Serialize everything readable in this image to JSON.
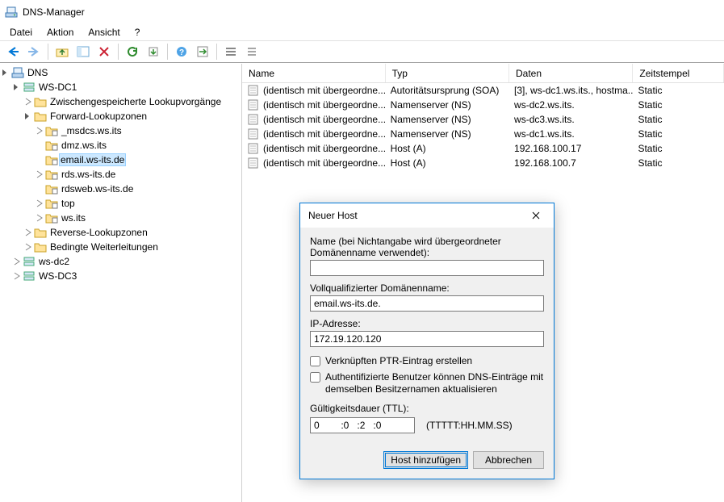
{
  "app": {
    "title": "DNS-Manager"
  },
  "menu": {
    "file": "Datei",
    "action": "Aktion",
    "view": "Ansicht",
    "help": "?"
  },
  "tree": {
    "root": "DNS",
    "server1": "WS-DC1",
    "cached": "Zwischengespeicherte Lookupvorgänge",
    "fwd": "Forward-Lookupzonen",
    "zones": [
      "_msdcs.ws.its",
      "dmz.ws.its",
      "email.ws-its.de",
      "rds.ws-its.de",
      "rdsweb.ws-its.de",
      "top",
      "ws.its"
    ],
    "rev": "Reverse-Lookupzonen",
    "cond": "Bedingte Weiterleitungen",
    "server2": "ws-dc2",
    "server3": "WS-DC3"
  },
  "columns": {
    "name": "Name",
    "type": "Typ",
    "data": "Daten",
    "timestamp": "Zeitstempel"
  },
  "records": [
    {
      "name": "(identisch mit übergeordne...",
      "type": "Autoritätsursprung (SOA)",
      "data": "[3], ws-dc1.ws.its., hostma...",
      "ts": "Static"
    },
    {
      "name": "(identisch mit übergeordne...",
      "type": "Namenserver (NS)",
      "data": "ws-dc2.ws.its.",
      "ts": "Static"
    },
    {
      "name": "(identisch mit übergeordne...",
      "type": "Namenserver (NS)",
      "data": "ws-dc3.ws.its.",
      "ts": "Static"
    },
    {
      "name": "(identisch mit übergeordne...",
      "type": "Namenserver (NS)",
      "data": "ws-dc1.ws.its.",
      "ts": "Static"
    },
    {
      "name": "(identisch mit übergeordne...",
      "type": "Host (A)",
      "data": "192.168.100.17",
      "ts": "Static"
    },
    {
      "name": "(identisch mit übergeordne...",
      "type": "Host (A)",
      "data": "192.168.100.7",
      "ts": "Static"
    }
  ],
  "dialog": {
    "title": "Neuer Host",
    "name_label": "Name (bei Nichtangabe wird übergeordneter Domänenname verwendet):",
    "name_value": "",
    "fqdn_label": "Vollqualifizierter Domänenname:",
    "fqdn_value": "email.ws-its.de.",
    "ip_label": "IP-Adresse:",
    "ip_value": "172.19.120.120",
    "ptr_label": "Verknüpften PTR-Eintrag erstellen",
    "auth_label": "Authentifizierte Benutzer können DNS-Einträge mit demselben Besitzernamen aktualisieren",
    "ttl_label": "Gültigkeitsdauer (TTL):",
    "ttl_value": "0        :0   :2   :0",
    "ttl_format": "(TTTTT:HH.MM.SS)",
    "ok": "Host hinzufügen",
    "cancel": "Abbrechen"
  }
}
